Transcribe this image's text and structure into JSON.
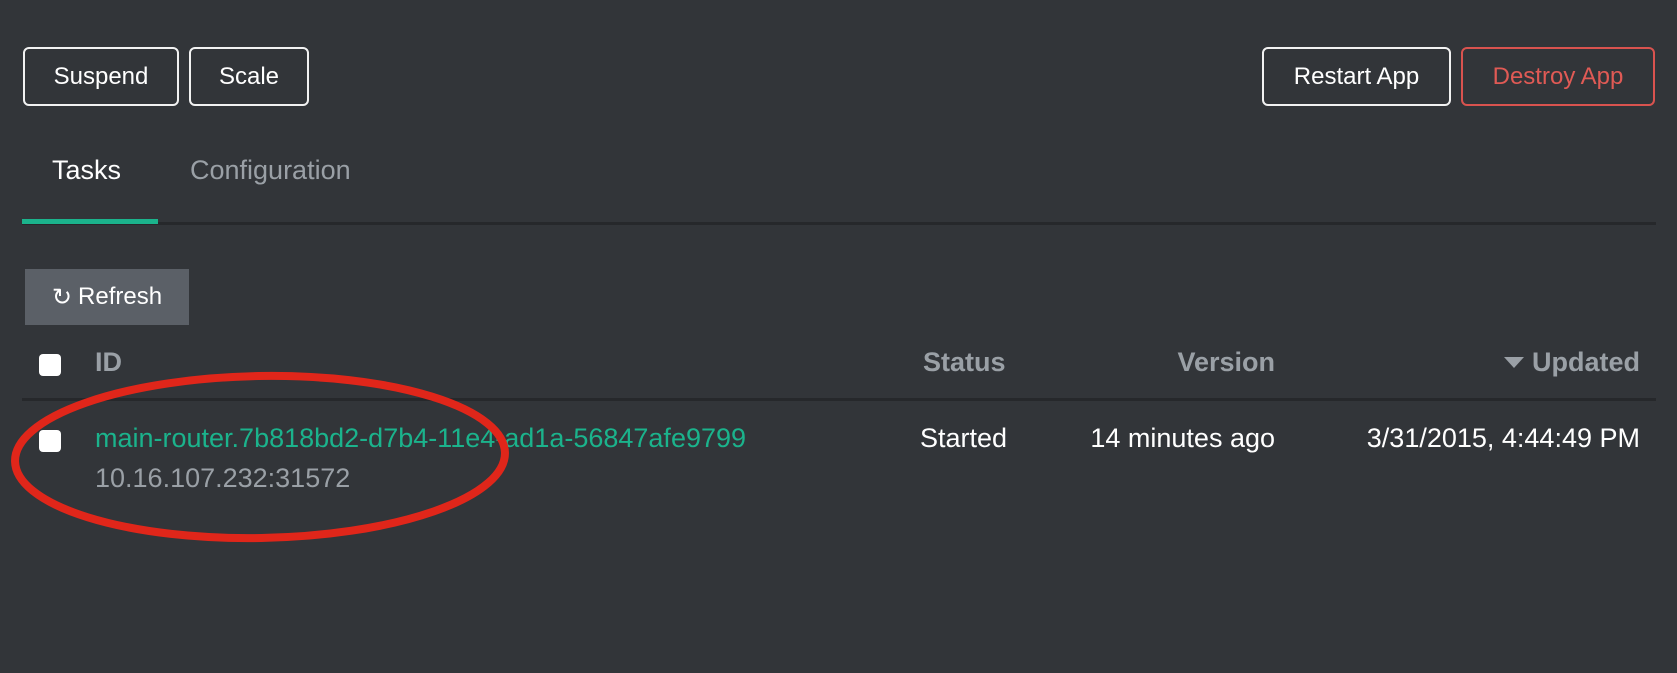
{
  "toolbar": {
    "suspend_label": "Suspend",
    "scale_label": "Scale",
    "restart_label": "Restart App",
    "destroy_label": "Destroy App"
  },
  "tabs": [
    {
      "label": "Tasks",
      "active": true
    },
    {
      "label": "Configuration",
      "active": false
    }
  ],
  "refresh": {
    "icon": "refresh-icon",
    "glyph": "↻",
    "label": "Refresh"
  },
  "table": {
    "columns": {
      "id": "ID",
      "status": "Status",
      "version": "Version",
      "updated": "Updated"
    },
    "sort": {
      "column": "updated",
      "direction": "descending"
    },
    "rows": [
      {
        "id": "main-router.7b818bd2-d7b4-11e4-ad1a-56847afe9799",
        "host": "10.16.107.232:31572",
        "status": "Started",
        "version": "14 minutes ago",
        "updated": "3/31/2015, 4:44:49 PM"
      }
    ]
  },
  "colors": {
    "background": "#323539",
    "accent": "#1bb38c",
    "danger": "#d9534f",
    "annotation": "#e0261a"
  }
}
